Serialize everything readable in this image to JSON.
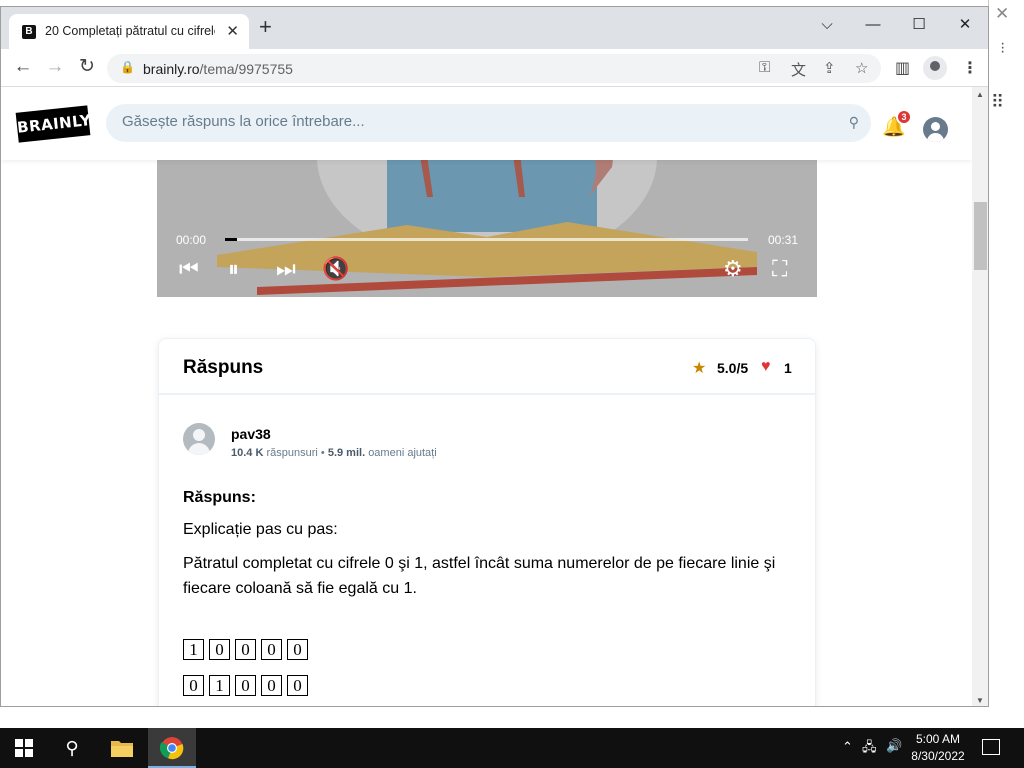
{
  "browser": {
    "tab_title": "20 Completați pătratul cu cifrele",
    "favicon_letter": "B",
    "url_host": "brainly.ro",
    "url_path": "/tema/9975755"
  },
  "site": {
    "logo_text": "BRAINLY",
    "search_placeholder": "Găsește răspuns la orice întrebare...",
    "notifications_count": "3"
  },
  "video": {
    "time_current": "00:00",
    "time_total": "00:31",
    "progress_fraction": 0.02
  },
  "answer": {
    "title": "Răspuns",
    "rating": "5.0/5",
    "thanks": "1",
    "author": {
      "name": "pav38",
      "answers_count": "10.4 K",
      "answers_label": "răspunsuri",
      "separator": "•",
      "helped_count": "5.9 mil.",
      "helped_label": "oameni ajutați"
    },
    "heading": "Răspuns:",
    "line1": "Explicație pas cu pas:",
    "line2": "Pătratul completat cu cifrele 0 şi 1, astfel încât suma numerelor de pe fiecare linie şi fiecare coloană să fie egală cu 1.",
    "grid": [
      [
        "1",
        "0",
        "0",
        "0",
        "0"
      ],
      [
        "0",
        "1",
        "0",
        "0",
        "0"
      ]
    ]
  },
  "taskbar": {
    "time": "5:00 AM",
    "date": "8/30/2022"
  },
  "colors": {
    "brand": "#000000",
    "badge": "#e03535",
    "star": "#c98600",
    "heart": "#e03535",
    "search_bg": "#ebf2f7"
  }
}
